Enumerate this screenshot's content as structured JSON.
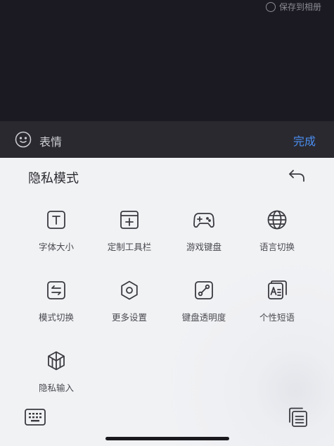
{
  "top": {
    "save_album_label": "保存到相册"
  },
  "emoji_bar": {
    "emoji_label": "表情",
    "done_label": "完成"
  },
  "keyboard": {
    "title": "隐私模式",
    "items": [
      {
        "label": "字体大小",
        "icon": "font-size-icon"
      },
      {
        "label": "定制工具栏",
        "icon": "toolbar-icon"
      },
      {
        "label": "游戏键盘",
        "icon": "gamepad-icon"
      },
      {
        "label": "语言切换",
        "icon": "globe-icon"
      },
      {
        "label": "模式切换",
        "icon": "switch-icon"
      },
      {
        "label": "更多设置",
        "icon": "gear-icon"
      },
      {
        "label": "键盘透明度",
        "icon": "transparency-icon"
      },
      {
        "label": "个性短语",
        "icon": "phrase-icon"
      },
      {
        "label": "隐私输入",
        "icon": "privacy-icon"
      }
    ]
  },
  "colors": {
    "accent": "#4a8ef0",
    "dark_bg": "#1b1a22",
    "bar_bg": "#2a2930",
    "keyboard_bg": "#f1f2f4"
  }
}
